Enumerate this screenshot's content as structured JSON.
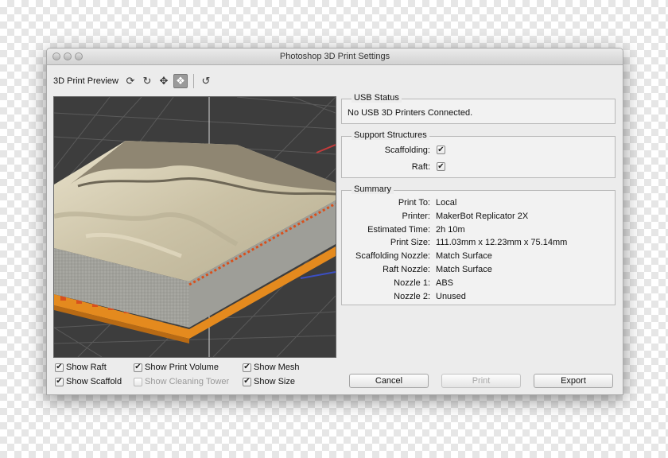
{
  "window": {
    "title": "Photoshop 3D Print Settings"
  },
  "toolbar": {
    "label": "3D Print Preview",
    "icons": [
      "orbit-icon",
      "roll-icon",
      "pan-icon",
      "slide-icon",
      "reset-view-icon"
    ],
    "glyphs": [
      "⟳",
      "↻",
      "✥",
      "❖",
      "↺"
    ]
  },
  "options": {
    "show_raft": "Show Raft",
    "show_scaffold": "Show Scaffold",
    "show_print_volume": "Show Print Volume",
    "show_cleaning_tower": "Show Cleaning Tower",
    "show_mesh": "Show Mesh",
    "show_size": "Show Size",
    "check_mark": "✔"
  },
  "usb_status": {
    "legend": "USB Status",
    "text": "No USB 3D Printers Connected."
  },
  "support": {
    "legend": "Support Structures",
    "scaffolding_label": "Scaffolding:",
    "raft_label": "Raft:"
  },
  "summary": {
    "legend": "Summary",
    "rows": [
      {
        "label": "Print To:",
        "value": "Local"
      },
      {
        "label": "Printer:",
        "value": "MakerBot Replicator 2X"
      },
      {
        "label": "Estimated Time:",
        "value": "2h 10m"
      },
      {
        "label": "Print Size:",
        "value": "111.03mm x 12.23mm x 75.14mm"
      },
      {
        "label": "Scaffolding Nozzle:",
        "value": "Match Surface"
      },
      {
        "label": "Raft Nozzle:",
        "value": "Match Surface"
      },
      {
        "label": "Nozzle 1:",
        "value": "ABS"
      },
      {
        "label": "Nozzle 2:",
        "value": "Unused"
      }
    ]
  },
  "buttons": {
    "cancel": "Cancel",
    "print": "Print",
    "export": "Export"
  },
  "colors": {
    "raft": "#e48a1e",
    "scaffold": "#d8501c",
    "model": "#d6cdb4",
    "grid_bg": "#3d3d3d"
  }
}
